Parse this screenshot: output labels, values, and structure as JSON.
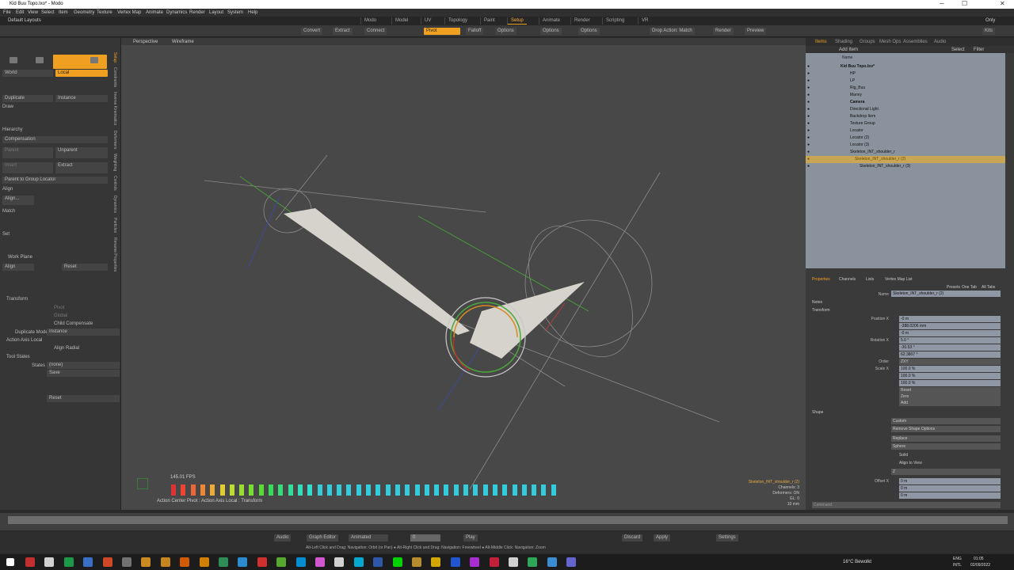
{
  "window": {
    "title": "Kid Buu Topo.lxo* - Modo"
  },
  "menu": [
    "File",
    "Edit",
    "View",
    "Select",
    "Item",
    "Geometry",
    "Texture",
    "Vertex Map",
    "Animate",
    "Dynamics",
    "Render",
    "Layout",
    "System",
    "Help"
  ],
  "layout": {
    "name": "Default Layouts",
    "tabs": [
      "Modo",
      "Model",
      "UV",
      "Topology",
      "Paint",
      "Setup",
      "Animate",
      "Render",
      "Scripting",
      "VR"
    ],
    "active_tab": "Setup",
    "right": "Only"
  },
  "toolbar": {
    "convert": "Convert",
    "extract": "Extract",
    "connect": "Connect",
    "pivot": "Pivot",
    "falloff": "Falloff",
    "options": "Options",
    "options2": "Options",
    "options3": "Options",
    "drop_action": "Drop Action: Match",
    "render": "Render",
    "preview": "Preview",
    "kits": "Kits"
  },
  "left": {
    "world": "World",
    "local": "Local",
    "duplicate": "Duplicate",
    "instance": "Instance",
    "draw": "Draw",
    "hierarchy": "Hierarchy",
    "compensation": "Compensation",
    "parent": "Parent",
    "unparent": "Unparent",
    "insert": "Insert",
    "extract": "Extract",
    "parent_group": "Parent to Group Locator",
    "align": "Align",
    "align_btn": "Align...",
    "match": "Match",
    "set": "Set",
    "work_plane": "Work Plane",
    "wp_align": "Align",
    "wp_reset": "Reset",
    "transform": "Transform",
    "pivot": "Pivot",
    "global": "Global",
    "child_comp": "Child Compensate",
    "dup_mode": "Duplicate Mode",
    "dup_val": "Instance",
    "action_axis": "Action Axis Local",
    "align_radial": "Align Radial",
    "tool_states": "Tool States",
    "states": "States",
    "states_val": "(none)",
    "save": "Save",
    "reset": "Reset"
  },
  "side_tabs": [
    "Setup",
    "Constraints",
    "Inverse Kinematics",
    "Deformers",
    "Weighting",
    "Controls",
    "Dynamics",
    "Particles",
    "Rename Properties"
  ],
  "viewport": {
    "view": "Perspective",
    "shade": "Wireframe",
    "fps": "145.01 FPS",
    "bottom_left": "Action Center Pivot : Action Axis Local : Transform",
    "info": [
      "Skeleton_INT_shoulder_r (2)",
      "Channels: 3",
      "Deformers: ON",
      "GL: 0",
      "10 mm"
    ]
  },
  "item_tabs": [
    "Items",
    "Shading",
    "Groups",
    "Mesh Ops",
    "Assemblies",
    "Audio"
  ],
  "item_list": {
    "add": "Add Item",
    "select": "Select",
    "filter": "Filter",
    "header": "Name",
    "rows": [
      {
        "name": "Kid Buu Topo.lxo*",
        "indent": 0,
        "sel": false
      },
      {
        "name": "HP",
        "indent": 2,
        "sel": false
      },
      {
        "name": "LP",
        "indent": 2,
        "sel": false
      },
      {
        "name": "Rig_Buu",
        "indent": 2,
        "sel": false
      },
      {
        "name": "Manny",
        "indent": 2,
        "sel": false
      },
      {
        "name": "Camera",
        "indent": 2,
        "sel": false
      },
      {
        "name": "Directional Light",
        "indent": 2,
        "sel": false
      },
      {
        "name": "Backdrop Item",
        "indent": 2,
        "sel": false
      },
      {
        "name": "Texture Group",
        "indent": 2,
        "sel": false
      },
      {
        "name": "Locator",
        "indent": 2,
        "sel": false
      },
      {
        "name": "Locator (2)",
        "indent": 2,
        "sel": false
      },
      {
        "name": "Locator (3)",
        "indent": 2,
        "sel": false
      },
      {
        "name": "Skeleton_INT_shoulder_r",
        "indent": 2,
        "sel": false
      },
      {
        "name": "Skeleton_INT_shoulder_r (2)",
        "indent": 3,
        "sel": true
      },
      {
        "name": "Skeleton_INT_shoulder_r (3)",
        "indent": 4,
        "sel": false
      }
    ]
  },
  "props_tabs": [
    "Properties",
    "Channels",
    "Lists",
    "Vertex Map List"
  ],
  "props": {
    "presets": "Presets",
    "one_tab": "One Tab",
    "all_tabs": "All Tabs",
    "name_label": "Name",
    "name": "Skeleton_INT_shoulder_r (2)",
    "notes": "Notes",
    "transform": "Transform",
    "position": [
      "-0 m",
      "-388.0206 mm",
      "-0 m"
    ],
    "rotation": [
      "5.0 °",
      "-30.53 °",
      "62.3807 °"
    ],
    "order": "ZXY",
    "scale": [
      "100.0 %",
      "100.0 %",
      "100.0 %"
    ],
    "reset": "Reset",
    "zero": "Zero",
    "add": "Add",
    "shape_sect": "Shape",
    "shape_label": "Shape",
    "shape": "Custom",
    "remove_shape": "Remove Shape Options",
    "style": "Replace",
    "shape2": "Sphere",
    "solid": "Solid",
    "align_view": "Align to View",
    "axis": "Z",
    "offset": [
      "0 m",
      "0 m",
      "0 m"
    ],
    "command": "Command"
  },
  "timeline": {
    "audio": "Audio",
    "graph": "Graph Editor",
    "animated": "Animated",
    "frame": "0",
    "play": "Play",
    "discard": "Discard",
    "apply": "Apply",
    "settings": "Settings",
    "hint": "Alt-Left Click and Drag: Navigation: Orbit (or Pan) ● Alt-Right Click and Drag: Navigation: Freewheel ● Alt-Middle Click: Navigation: Zoom"
  },
  "taskbar": {
    "weather": "16°C Bewolkt",
    "lang1": "ENG",
    "lang2": "INTL",
    "time": "01:05",
    "date": "02/09/2022"
  }
}
